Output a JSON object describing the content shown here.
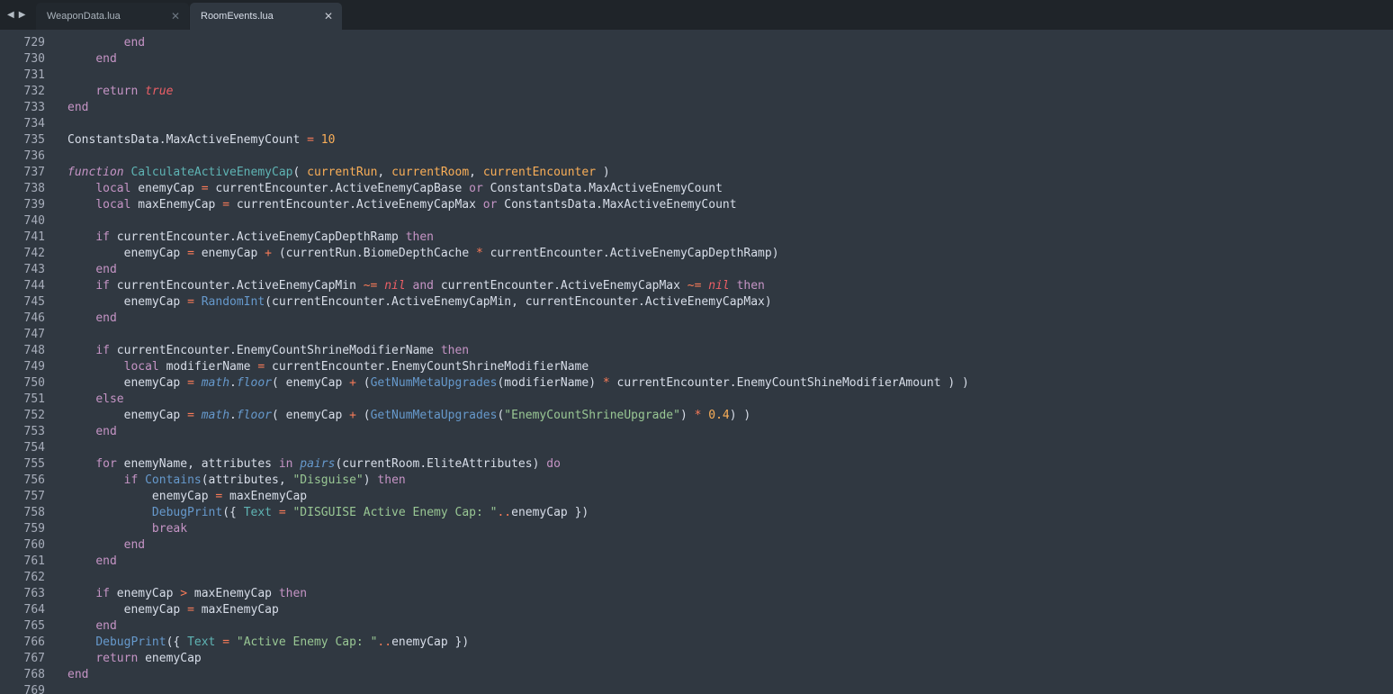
{
  "tabs": [
    {
      "label": "WeaponData.lua",
      "active": false
    },
    {
      "label": "RoomEvents.lua",
      "active": true
    }
  ],
  "icons": {
    "back": "chevron-left-icon",
    "forward": "chevron-right-icon",
    "close": "close-icon"
  },
  "colors": {
    "background": "#303841",
    "tabbar": "#1f2429",
    "keyword": "#c594c5",
    "function": "#6699cc",
    "operator": "#f97b58",
    "boolean": "#ec5f66",
    "number": "#f9ae58",
    "string": "#99c794",
    "definition": "#5fb4b4"
  },
  "lines": [
    {
      "n": "729",
      "tokens": [
        [
          "        ",
          ""
        ],
        [
          "end",
          "kw"
        ]
      ]
    },
    {
      "n": "730",
      "tokens": [
        [
          "    ",
          ""
        ],
        [
          "end",
          "kw"
        ]
      ]
    },
    {
      "n": "731",
      "tokens": []
    },
    {
      "n": "732",
      "tokens": [
        [
          "    ",
          ""
        ],
        [
          "return",
          "kw"
        ],
        [
          " ",
          ""
        ],
        [
          "true",
          "bool"
        ]
      ]
    },
    {
      "n": "733",
      "tokens": [
        [
          "end",
          "kw"
        ]
      ]
    },
    {
      "n": "734",
      "tokens": []
    },
    {
      "n": "735",
      "tokens": [
        [
          "ConstantsData.MaxActiveEnemyCount ",
          ""
        ],
        [
          "=",
          "op"
        ],
        [
          " ",
          ""
        ],
        [
          "10",
          "num"
        ]
      ]
    },
    {
      "n": "736",
      "tokens": []
    },
    {
      "n": "737",
      "tokens": [
        [
          "function",
          "kwi"
        ],
        [
          " ",
          ""
        ],
        [
          "CalculateActiveEnemyCap",
          "fdef"
        ],
        [
          "( ",
          "pun"
        ],
        [
          "currentRun",
          "param"
        ],
        [
          ", ",
          "pun"
        ],
        [
          "currentRoom",
          "param"
        ],
        [
          ", ",
          "pun"
        ],
        [
          "currentEncounter",
          "param"
        ],
        [
          " )",
          "pun"
        ]
      ]
    },
    {
      "n": "738",
      "tokens": [
        [
          "    ",
          ""
        ],
        [
          "local",
          "kw"
        ],
        [
          " enemyCap ",
          ""
        ],
        [
          "=",
          "op"
        ],
        [
          " currentEncounter.ActiveEnemyCapBase ",
          ""
        ],
        [
          "or",
          "kw"
        ],
        [
          " ConstantsData.MaxActiveEnemyCount",
          ""
        ]
      ]
    },
    {
      "n": "739",
      "tokens": [
        [
          "    ",
          ""
        ],
        [
          "local",
          "kw"
        ],
        [
          " maxEnemyCap ",
          ""
        ],
        [
          "=",
          "op"
        ],
        [
          " currentEncounter.ActiveEnemyCapMax ",
          ""
        ],
        [
          "or",
          "kw"
        ],
        [
          " ConstantsData.MaxActiveEnemyCount",
          ""
        ]
      ]
    },
    {
      "n": "740",
      "tokens": []
    },
    {
      "n": "741",
      "tokens": [
        [
          "    ",
          ""
        ],
        [
          "if",
          "kw"
        ],
        [
          " currentEncounter.ActiveEnemyCapDepthRamp ",
          ""
        ],
        [
          "then",
          "kw"
        ]
      ]
    },
    {
      "n": "742",
      "tokens": [
        [
          "        enemyCap ",
          ""
        ],
        [
          "=",
          "op"
        ],
        [
          " enemyCap ",
          ""
        ],
        [
          "+",
          "op"
        ],
        [
          " (currentRun.BiomeDepthCache ",
          ""
        ],
        [
          "*",
          "op"
        ],
        [
          " currentEncounter.ActiveEnemyCapDepthRamp)",
          ""
        ]
      ]
    },
    {
      "n": "743",
      "tokens": [
        [
          "    ",
          ""
        ],
        [
          "end",
          "kw"
        ]
      ]
    },
    {
      "n": "744",
      "tokens": [
        [
          "    ",
          ""
        ],
        [
          "if",
          "kw"
        ],
        [
          " currentEncounter.ActiveEnemyCapMin ",
          ""
        ],
        [
          "~=",
          "op"
        ],
        [
          " ",
          ""
        ],
        [
          "nil",
          "bool"
        ],
        [
          " ",
          ""
        ],
        [
          "and",
          "kw"
        ],
        [
          " currentEncounter.ActiveEnemyCapMax ",
          ""
        ],
        [
          "~=",
          "op"
        ],
        [
          " ",
          ""
        ],
        [
          "nil",
          "bool"
        ],
        [
          " ",
          ""
        ],
        [
          "then",
          "kw"
        ]
      ]
    },
    {
      "n": "745",
      "tokens": [
        [
          "        enemyCap ",
          ""
        ],
        [
          "=",
          "op"
        ],
        [
          " ",
          ""
        ],
        [
          "RandomInt",
          "fn"
        ],
        [
          "(currentEncounter.ActiveEnemyCapMin, currentEncounter.ActiveEnemyCapMax)",
          ""
        ]
      ]
    },
    {
      "n": "746",
      "tokens": [
        [
          "    ",
          ""
        ],
        [
          "end",
          "kw"
        ]
      ]
    },
    {
      "n": "747",
      "tokens": []
    },
    {
      "n": "748",
      "tokens": [
        [
          "    ",
          ""
        ],
        [
          "if",
          "kw"
        ],
        [
          " currentEncounter.EnemyCountShrineModifierName ",
          ""
        ],
        [
          "then",
          "kw"
        ]
      ]
    },
    {
      "n": "749",
      "tokens": [
        [
          "        ",
          ""
        ],
        [
          "local",
          "kw"
        ],
        [
          " modifierName ",
          ""
        ],
        [
          "=",
          "op"
        ],
        [
          " currentEncounter.EnemyCountShrineModifierName",
          ""
        ]
      ]
    },
    {
      "n": "750",
      "tokens": [
        [
          "        enemyCap ",
          ""
        ],
        [
          "=",
          "op"
        ],
        [
          " ",
          ""
        ],
        [
          "math",
          "fni"
        ],
        [
          ".",
          ""
        ],
        [
          "floor",
          "fni"
        ],
        [
          "( enemyCap ",
          ""
        ],
        [
          "+",
          "op"
        ],
        [
          " (",
          ""
        ],
        [
          "GetNumMetaUpgrades",
          "fn"
        ],
        [
          "(modifierName) ",
          ""
        ],
        [
          "*",
          "op"
        ],
        [
          " currentEncounter.EnemyCountShineModifierAmount ) )",
          ""
        ]
      ]
    },
    {
      "n": "751",
      "tokens": [
        [
          "    ",
          ""
        ],
        [
          "else",
          "kw"
        ]
      ]
    },
    {
      "n": "752",
      "tokens": [
        [
          "        enemyCap ",
          ""
        ],
        [
          "=",
          "op"
        ],
        [
          " ",
          ""
        ],
        [
          "math",
          "fni"
        ],
        [
          ".",
          ""
        ],
        [
          "floor",
          "fni"
        ],
        [
          "( enemyCap ",
          ""
        ],
        [
          "+",
          "op"
        ],
        [
          " (",
          ""
        ],
        [
          "GetNumMetaUpgrades",
          "fn"
        ],
        [
          "(",
          ""
        ],
        [
          "\"EnemyCountShrineUpgrade\"",
          "str"
        ],
        [
          ") ",
          ""
        ],
        [
          "*",
          "op"
        ],
        [
          " ",
          ""
        ],
        [
          "0.4",
          "num"
        ],
        [
          ") )",
          ""
        ]
      ]
    },
    {
      "n": "753",
      "tokens": [
        [
          "    ",
          ""
        ],
        [
          "end",
          "kw"
        ]
      ]
    },
    {
      "n": "754",
      "tokens": []
    },
    {
      "n": "755",
      "tokens": [
        [
          "    ",
          ""
        ],
        [
          "for",
          "kw"
        ],
        [
          " enemyName, attributes ",
          ""
        ],
        [
          "in",
          "kw"
        ],
        [
          " ",
          ""
        ],
        [
          "pairs",
          "fni"
        ],
        [
          "(currentRoom.EliteAttributes) ",
          ""
        ],
        [
          "do",
          "kw"
        ]
      ]
    },
    {
      "n": "756",
      "tokens": [
        [
          "        ",
          ""
        ],
        [
          "if",
          "kw"
        ],
        [
          " ",
          ""
        ],
        [
          "Contains",
          "fn"
        ],
        [
          "(attributes, ",
          ""
        ],
        [
          "\"Disguise\"",
          "str"
        ],
        [
          ") ",
          ""
        ],
        [
          "then",
          "kw"
        ]
      ]
    },
    {
      "n": "757",
      "tokens": [
        [
          "            enemyCap ",
          ""
        ],
        [
          "=",
          "op"
        ],
        [
          " maxEnemyCap",
          ""
        ]
      ]
    },
    {
      "n": "758",
      "tokens": [
        [
          "            ",
          ""
        ],
        [
          "DebugPrint",
          "fn"
        ],
        [
          "({ ",
          ""
        ],
        [
          "Text",
          "tblk"
        ],
        [
          " ",
          ""
        ],
        [
          "=",
          "op"
        ],
        [
          " ",
          ""
        ],
        [
          "\"DISGUISE Active Enemy Cap: \"",
          "str"
        ],
        [
          "..",
          "op"
        ],
        [
          "enemyCap })",
          ""
        ]
      ]
    },
    {
      "n": "759",
      "tokens": [
        [
          "            ",
          ""
        ],
        [
          "break",
          "kw"
        ]
      ]
    },
    {
      "n": "760",
      "tokens": [
        [
          "        ",
          ""
        ],
        [
          "end",
          "kw"
        ]
      ]
    },
    {
      "n": "761",
      "tokens": [
        [
          "    ",
          ""
        ],
        [
          "end",
          "kw"
        ]
      ]
    },
    {
      "n": "762",
      "tokens": []
    },
    {
      "n": "763",
      "tokens": [
        [
          "    ",
          ""
        ],
        [
          "if",
          "kw"
        ],
        [
          " enemyCap ",
          ""
        ],
        [
          ">",
          "op"
        ],
        [
          " maxEnemyCap ",
          ""
        ],
        [
          "then",
          "kw"
        ]
      ]
    },
    {
      "n": "764",
      "tokens": [
        [
          "        enemyCap ",
          ""
        ],
        [
          "=",
          "op"
        ],
        [
          " maxEnemyCap",
          ""
        ]
      ]
    },
    {
      "n": "765",
      "tokens": [
        [
          "    ",
          ""
        ],
        [
          "end",
          "kw"
        ]
      ]
    },
    {
      "n": "766",
      "tokens": [
        [
          "    ",
          ""
        ],
        [
          "DebugPrint",
          "fn"
        ],
        [
          "({ ",
          ""
        ],
        [
          "Text",
          "tblk"
        ],
        [
          " ",
          ""
        ],
        [
          "=",
          "op"
        ],
        [
          " ",
          ""
        ],
        [
          "\"Active Enemy Cap: \"",
          "str"
        ],
        [
          "..",
          "op"
        ],
        [
          "enemyCap })",
          ""
        ]
      ]
    },
    {
      "n": "767",
      "tokens": [
        [
          "    ",
          ""
        ],
        [
          "return",
          "kw"
        ],
        [
          " enemyCap",
          ""
        ]
      ]
    },
    {
      "n": "768",
      "tokens": [
        [
          "end",
          "kw"
        ]
      ]
    },
    {
      "n": "769",
      "tokens": []
    }
  ]
}
